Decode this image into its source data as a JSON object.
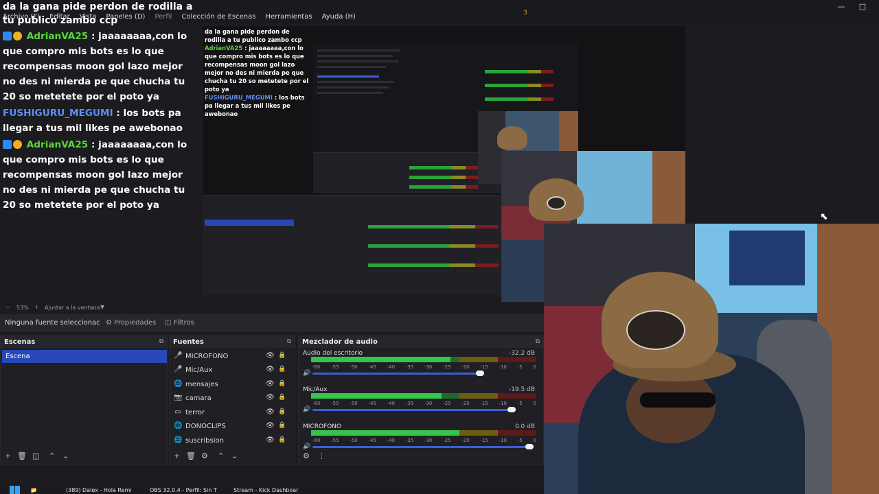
{
  "menubar": {
    "items": [
      "Archivo (F)",
      "Editar",
      "Vista",
      "Paneles (D)",
      "Perfil",
      "Colección de Escenas",
      "Herramientas",
      "Ayuda (H)"
    ],
    "center_mark": "3"
  },
  "chat": {
    "title": "da la gana pide perdon de rodilla a tu publico zambo ccp",
    "messages": [
      {
        "user": "AdrianVA25",
        "text": ": jaaaaaaaa,con lo que compro mis bots es lo que recompensas moon gol lazo mejor no des ni mierda pe que chucha tu 20 so metetete por el poto ya"
      },
      {
        "user": "FUSHIGURU_MEGUMI",
        "text": ": los bots pa llegar a tus mil likes pe awebonao"
      },
      {
        "user": "AdrianVA25",
        "text": ": jaaaaaaaa,con lo que compro mis bots es lo que recompensas moon gol lazo mejor no des ni mierda pe que chucha tu 20 so metetete por el poto ya"
      }
    ]
  },
  "preview": {
    "zoom": "53%",
    "fit_label": "Ajustar a la ventana"
  },
  "properties": {
    "no_source": "Ninguna fuente seleccionac",
    "tab_props": "Propiedades",
    "tab_filters": "Filtros"
  },
  "scenes": {
    "title": "Escenas",
    "items": [
      "Escena"
    ]
  },
  "sources": {
    "title": "Fuentes",
    "items": [
      {
        "name": "MICROFONO",
        "icon": "microphone-icon"
      },
      {
        "name": "Mic/Aux",
        "icon": "microphone-icon"
      },
      {
        "name": "mensajes",
        "icon": "globe-icon"
      },
      {
        "name": "camara",
        "icon": "camera-icon"
      },
      {
        "name": "terror",
        "icon": "monitor-icon"
      },
      {
        "name": "DONOCLIPS",
        "icon": "globe-icon"
      },
      {
        "name": "suscribsion",
        "icon": "globe-icon"
      }
    ]
  },
  "mixer": {
    "title": "Mezclador de audio",
    "ticks": [
      "-60",
      "-55",
      "-50",
      "-45",
      "-40",
      "-35",
      "-30",
      "-25",
      "-20",
      "-15",
      "-10",
      "-5",
      "0"
    ],
    "channels": [
      {
        "name": "Audio del escritorio",
        "db": "-32.2 dB",
        "level": 0.62,
        "volume": 0.78
      },
      {
        "name": "Mic/Aux",
        "db": "-19.5 dB",
        "level": 0.58,
        "volume": 0.92
      },
      {
        "name": "MICROFONO",
        "db": "0.0 dB",
        "level": 0.66,
        "volume": 1.0
      }
    ]
  },
  "taskbar": {
    "items": [
      "(389) Dalex - Hola Remi",
      "OBS 32.0.4 - Perfil: Sin T",
      "Stream - Kick Dashboar"
    ]
  },
  "colors": {
    "accent": "#2848b8",
    "chat_user": "#57d639",
    "chat_user2": "#5d8ff6"
  }
}
